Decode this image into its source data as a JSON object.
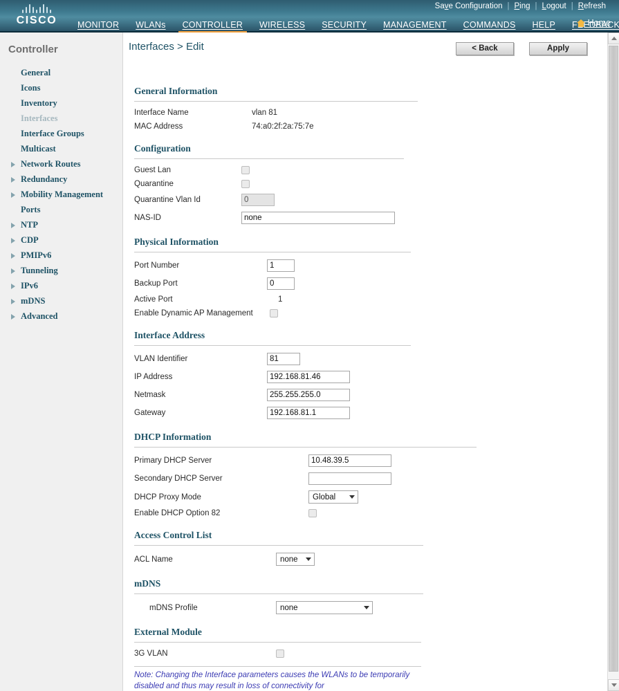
{
  "brand": {
    "name": "CISCO",
    "logo_icon": "cisco-bars-logo"
  },
  "utility_links": [
    {
      "label": "Save Configuration",
      "accel": "v"
    },
    {
      "label": "Ping",
      "accel": "P"
    },
    {
      "label": "Logout",
      "accel": "L"
    },
    {
      "label": "Refresh",
      "accel": "R"
    }
  ],
  "main_nav": [
    {
      "label": "MONITOR",
      "active": false
    },
    {
      "label": "WLANs",
      "active": false
    },
    {
      "label": "CONTROLLER",
      "active": true
    },
    {
      "label": "WIRELESS",
      "active": false
    },
    {
      "label": "SECURITY",
      "active": false
    },
    {
      "label": "MANAGEMENT",
      "active": false
    },
    {
      "label": "COMMANDS",
      "active": false
    },
    {
      "label": "HELP",
      "active": false
    },
    {
      "label": "FEEDBACK",
      "active": false
    }
  ],
  "home_link": {
    "label": "Home",
    "icon": "home-icon"
  },
  "sidebar": {
    "title": "Controller",
    "items": [
      {
        "label": "General",
        "arrow": false,
        "current": false
      },
      {
        "label": "Icons",
        "arrow": false,
        "current": false
      },
      {
        "label": "Inventory",
        "arrow": false,
        "current": false
      },
      {
        "label": "Interfaces",
        "arrow": false,
        "current": true
      },
      {
        "label": "Interface Groups",
        "arrow": false,
        "current": false
      },
      {
        "label": "Multicast",
        "arrow": false,
        "current": false
      },
      {
        "label": "Network Routes",
        "arrow": true,
        "current": false
      },
      {
        "label": "Redundancy",
        "arrow": true,
        "current": false
      },
      {
        "label": "Mobility Management",
        "arrow": true,
        "current": false
      },
      {
        "label": "Ports",
        "arrow": false,
        "current": false
      },
      {
        "label": "NTP",
        "arrow": true,
        "current": false
      },
      {
        "label": "CDP",
        "arrow": true,
        "current": false
      },
      {
        "label": "PMIPv6",
        "arrow": true,
        "current": false
      },
      {
        "label": "Tunneling",
        "arrow": true,
        "current": false
      },
      {
        "label": "IPv6",
        "arrow": true,
        "current": false
      },
      {
        "label": "mDNS",
        "arrow": true,
        "current": false
      },
      {
        "label": "Advanced",
        "arrow": true,
        "current": false
      }
    ]
  },
  "page": {
    "breadcrumb": "Interfaces > Edit",
    "back_button": "< Back",
    "apply_button": "Apply"
  },
  "general_information": {
    "title": "General Information",
    "interface_name_label": "Interface Name",
    "interface_name_value": "vlan 81",
    "mac_address_label": "MAC Address",
    "mac_address_value": "74:a0:2f:2a:75:7e"
  },
  "configuration": {
    "title": "Configuration",
    "guest_lan_label": "Guest Lan",
    "guest_lan_checked": false,
    "quarantine_label": "Quarantine",
    "quarantine_checked": false,
    "quarantine_vlan_id_label": "Quarantine Vlan Id",
    "quarantine_vlan_id_value": "0",
    "nas_id_label": "NAS-ID",
    "nas_id_value": "none"
  },
  "physical_information": {
    "title": "Physical Information",
    "port_number_label": "Port Number",
    "port_number_value": "1",
    "backup_port_label": "Backup Port",
    "backup_port_value": "0",
    "active_port_label": "Active Port",
    "active_port_value": "1",
    "dynamic_ap_label": "Enable Dynamic AP Management",
    "dynamic_ap_checked": false
  },
  "interface_address": {
    "title": "Interface Address",
    "vlan_identifier_label": "VLAN Identifier",
    "vlan_identifier_value": "81",
    "ip_address_label": "IP Address",
    "ip_address_value": "192.168.81.46",
    "netmask_label": "Netmask",
    "netmask_value": "255.255.255.0",
    "gateway_label": "Gateway",
    "gateway_value": "192.168.81.1"
  },
  "dhcp_information": {
    "title": "DHCP Information",
    "primary_label": "Primary DHCP Server",
    "primary_value": "10.48.39.5",
    "secondary_label": "Secondary DHCP Server",
    "secondary_value": "",
    "proxy_mode_label": "DHCP Proxy Mode",
    "proxy_mode_value": "Global",
    "option82_label": "Enable DHCP Option 82",
    "option82_checked": false
  },
  "access_control_list": {
    "title": "Access Control List",
    "acl_name_label": "ACL Name",
    "acl_name_value": "none"
  },
  "mdns": {
    "title": "mDNS",
    "profile_label": "mDNS Profile",
    "profile_value": "none"
  },
  "external_module": {
    "title": "External Module",
    "vlan_3g_label": "3G VLAN",
    "vlan_3g_checked": false
  },
  "footer_note": "Note: Changing the Interface parameters causes the WLANs to be temporarily disabled and thus may result in loss of connectivity for",
  "colors": {
    "banner_teal": "#3f7b90",
    "accent_orange": "#f2a03d",
    "heading_blue": "#1f5366",
    "note_blue": "#3b3bb3"
  }
}
